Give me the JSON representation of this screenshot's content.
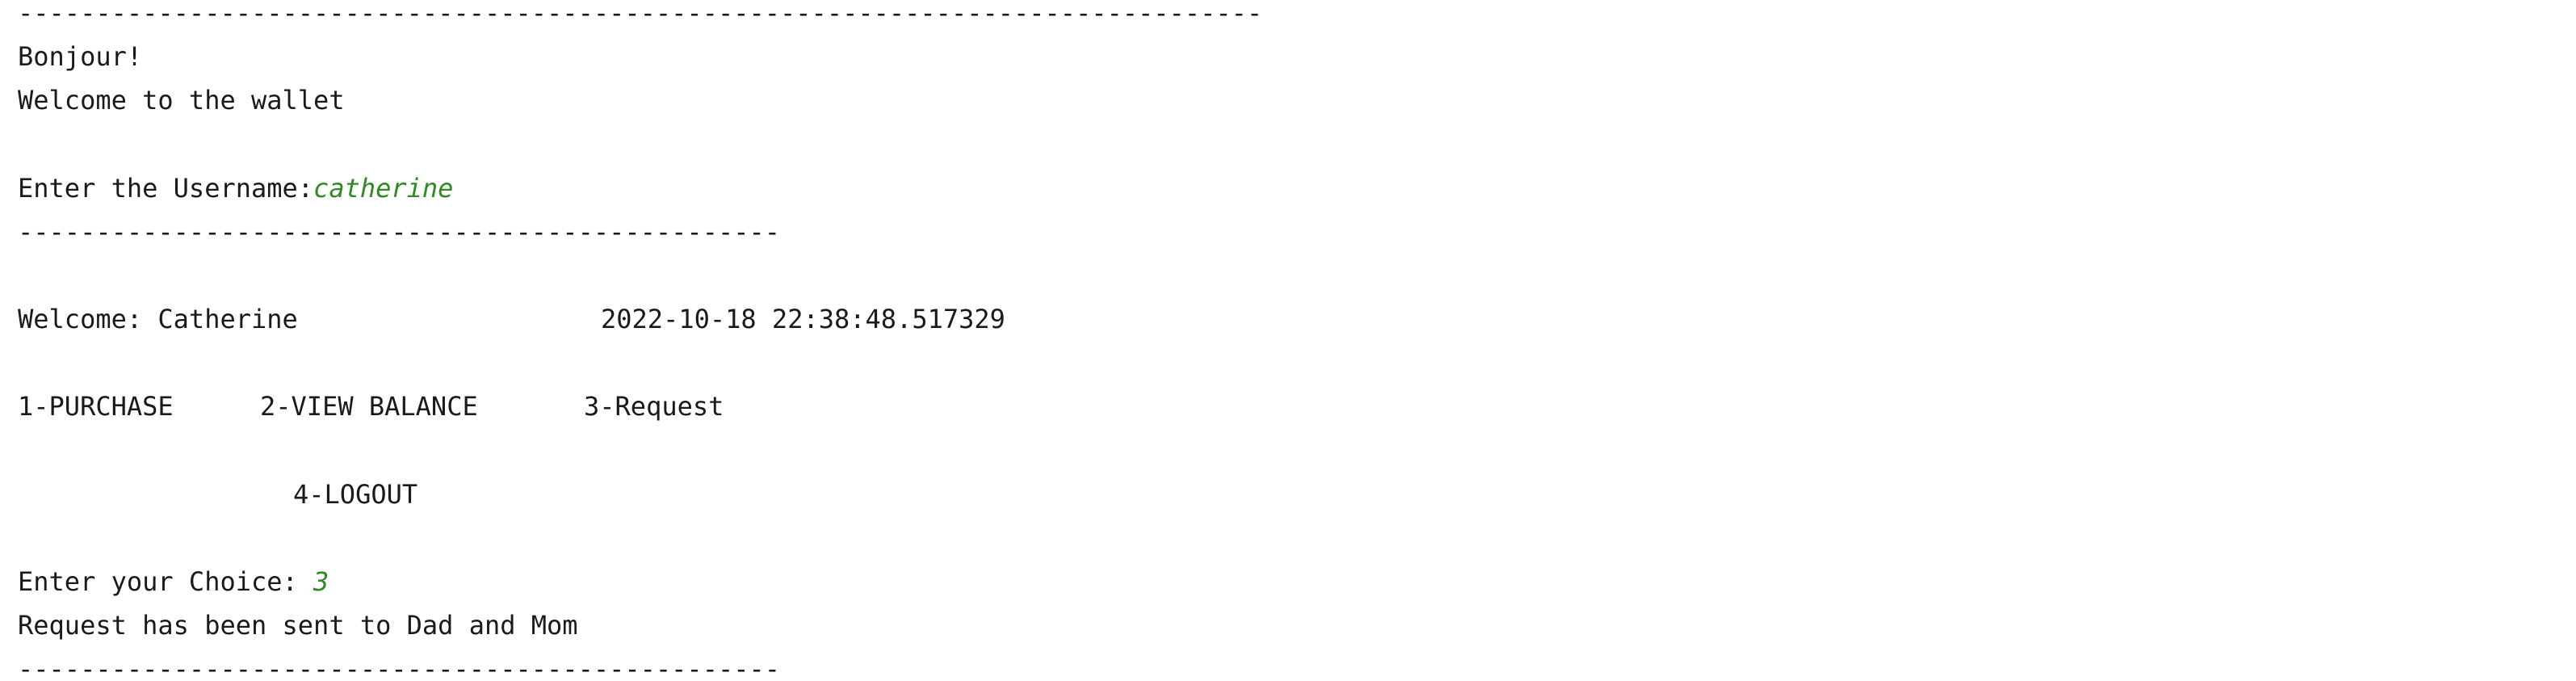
{
  "console": {
    "separator_long": "--------------------------------------------------------------------------------",
    "greeting": "Bonjour!",
    "welcome_wallet": "Welcome to the wallet",
    "username_prompt": "Enter the Username:",
    "username_input": "catherine",
    "separator_short": "-------------------------------------------------",
    "welcome_user": "Welcome: Catherine",
    "timestamp": "2022-10-18 22:38:48.517329",
    "menu": {
      "purchase": "1-PURCHASE",
      "view_balance": "2-VIEW BALANCE",
      "request": "3-Request",
      "logout": "4-LOGOUT"
    },
    "choice_prompt": "Enter your Choice: ",
    "choice_input": "3",
    "request_result": "Request has been sent to Dad and Mom",
    "separator_bottom": "-------------------------------------------------"
  }
}
